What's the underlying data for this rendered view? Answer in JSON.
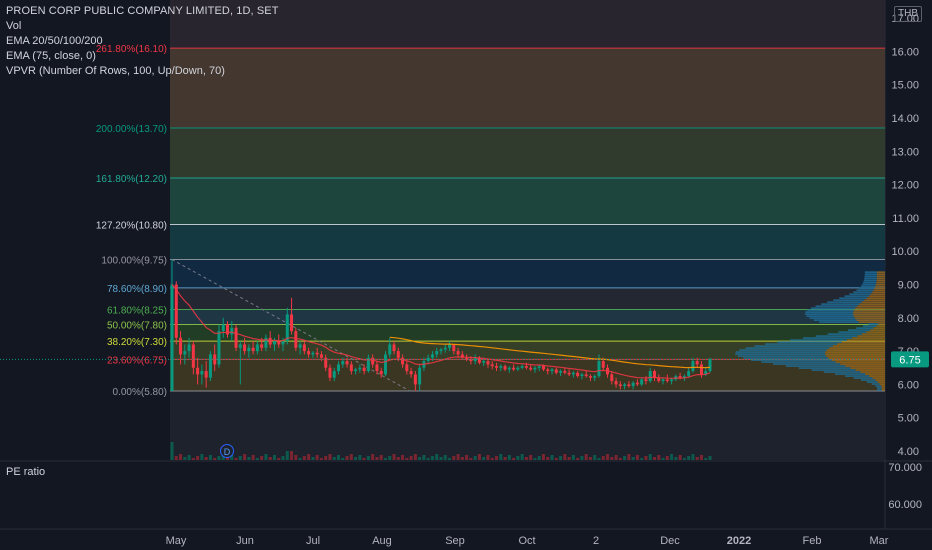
{
  "header": {
    "title": "PROEN CORP PUBLIC COMPANY LIMITED, 1D, SET",
    "indicators": [
      "Vol",
      "EMA 20/50/100/200",
      "EMA (75, close, 0)",
      "VPVR (Number Of Rows, 100, Up/Down, 70)"
    ],
    "currency": "THB"
  },
  "sub_pane": {
    "label": "PE ratio",
    "ticks": [
      "70.000",
      "60.000"
    ]
  },
  "chart_data": {
    "type": "candlestick",
    "symbol": "PROEN",
    "exchange": "SET",
    "interval": "1D",
    "currency": "THB",
    "ylim": [
      3.0,
      17.6
    ],
    "y_ticks": [
      "4.00",
      "5.00",
      "6.00",
      "7.00",
      "8.00",
      "9.00",
      "10.00",
      "11.00",
      "12.00",
      "13.00",
      "14.00",
      "15.00",
      "16.00",
      "17.00"
    ],
    "x_ticks": [
      "May",
      "Jun",
      "Jul",
      "Aug",
      "Sep",
      "Oct",
      "2",
      "Dec",
      "2022",
      "Feb",
      "Mar"
    ],
    "last_price": "6.75",
    "fibonacci": [
      {
        "label": "261.80%(16.10)",
        "price": 16.1,
        "color": "#f23645"
      },
      {
        "label": "200.00%(13.70)",
        "price": 13.7,
        "color": "#089981"
      },
      {
        "label": "161.80%(12.20)",
        "price": 12.2,
        "color": "#22ab94"
      },
      {
        "label": "127.20%(10.80)",
        "price": 10.8,
        "color": "#d1d4dc"
      },
      {
        "label": "100.00%(9.75)",
        "price": 9.75,
        "color": "#9598a1"
      },
      {
        "label": "78.60%(8.90)",
        "price": 8.9,
        "color": "#5fa8d3"
      },
      {
        "label": "61.80%(8.25)",
        "price": 8.25,
        "color": "#4caf50"
      },
      {
        "label": "50.00%(7.80)",
        "price": 7.8,
        "color": "#8bc34a"
      },
      {
        "label": "38.20%(7.30)",
        "price": 7.3,
        "color": "#cddc39"
      },
      {
        "label": "23.60%(6.75)",
        "price": 6.75,
        "color": "#f23645"
      },
      {
        "label": "0.00%(5.80)",
        "price": 5.8,
        "color": "#9598a1"
      }
    ],
    "dividend_marker": "D",
    "candles": [
      [
        0,
        5.8,
        9.75,
        5.8,
        9.0
      ],
      [
        1,
        9.0,
        9.1,
        7.2,
        7.4
      ],
      [
        2,
        7.4,
        7.6,
        6.6,
        6.9
      ],
      [
        3,
        6.9,
        7.2,
        6.6,
        7.0
      ],
      [
        4,
        7.0,
        7.4,
        6.8,
        7.2
      ],
      [
        5,
        7.2,
        7.3,
        6.3,
        6.5
      ],
      [
        6,
        6.5,
        6.8,
        6.0,
        6.3
      ],
      [
        7,
        6.3,
        6.6,
        6.0,
        6.4
      ],
      [
        8,
        6.4,
        6.7,
        5.9,
        6.2
      ],
      [
        9,
        6.2,
        7.0,
        6.1,
        6.9
      ],
      [
        10,
        6.9,
        7.2,
        6.4,
        6.6
      ],
      [
        11,
        6.6,
        7.8,
        6.5,
        7.6
      ],
      [
        12,
        7.6,
        8.0,
        7.4,
        7.8
      ],
      [
        13,
        7.8,
        7.9,
        7.4,
        7.5
      ],
      [
        14,
        7.5,
        7.9,
        7.3,
        7.7
      ],
      [
        15,
        7.7,
        7.8,
        7.0,
        7.1
      ],
      [
        16,
        7.1,
        7.3,
        6.0,
        7.2
      ],
      [
        17,
        7.2,
        7.4,
        6.9,
        7.0
      ],
      [
        18,
        7.0,
        7.2,
        6.8,
        7.1
      ],
      [
        19,
        7.1,
        7.3,
        6.9,
        7.0
      ],
      [
        20,
        7.0,
        7.3,
        6.9,
        7.2
      ],
      [
        21,
        7.2,
        7.4,
        7.0,
        7.1
      ],
      [
        22,
        7.1,
        7.5,
        7.0,
        7.4
      ],
      [
        23,
        7.4,
        7.6,
        7.1,
        7.2
      ],
      [
        24,
        7.2,
        7.4,
        7.0,
        7.3
      ],
      [
        25,
        7.3,
        7.5,
        7.1,
        7.2
      ],
      [
        26,
        7.2,
        7.4,
        7.0,
        7.3
      ],
      [
        27,
        7.3,
        8.3,
        7.2,
        8.1
      ],
      [
        28,
        8.1,
        8.6,
        7.5,
        7.6
      ],
      [
        29,
        7.6,
        7.7,
        7.0,
        7.1
      ],
      [
        30,
        7.1,
        7.3,
        6.9,
        7.2
      ],
      [
        31,
        7.2,
        7.3,
        6.9,
        7.0
      ],
      [
        32,
        7.0,
        7.1,
        6.8,
        6.9
      ],
      [
        33,
        6.9,
        7.0,
        6.8,
        6.95
      ],
      [
        34,
        6.95,
        7.1,
        6.8,
        6.9
      ],
      [
        35,
        6.9,
        7.0,
        6.7,
        6.8
      ],
      [
        36,
        6.8,
        6.9,
        6.4,
        6.5
      ],
      [
        37,
        6.5,
        6.6,
        6.1,
        6.2
      ],
      [
        38,
        6.2,
        6.5,
        6.1,
        6.4
      ],
      [
        39,
        6.4,
        6.7,
        6.3,
        6.6
      ],
      [
        40,
        6.6,
        6.8,
        6.5,
        6.7
      ],
      [
        41,
        6.7,
        6.8,
        6.5,
        6.6
      ],
      [
        42,
        6.6,
        6.7,
        6.3,
        6.4
      ],
      [
        43,
        6.4,
        6.5,
        6.3,
        6.45
      ],
      [
        44,
        6.45,
        6.6,
        6.35,
        6.5
      ],
      [
        45,
        6.5,
        6.6,
        6.3,
        6.4
      ],
      [
        46,
        6.4,
        6.9,
        6.35,
        6.8
      ],
      [
        47,
        6.8,
        6.9,
        6.5,
        6.6
      ],
      [
        48,
        6.6,
        6.7,
        6.3,
        6.4
      ],
      [
        49,
        6.4,
        6.5,
        6.2,
        6.3
      ],
      [
        50,
        6.3,
        7.0,
        6.25,
        6.9
      ],
      [
        51,
        6.9,
        7.4,
        6.8,
        7.2
      ],
      [
        52,
        7.2,
        7.3,
        6.9,
        7.0
      ],
      [
        53,
        7.0,
        7.1,
        6.7,
        6.8
      ],
      [
        54,
        6.8,
        6.9,
        6.5,
        6.6
      ],
      [
        55,
        6.6,
        6.7,
        6.3,
        6.4
      ],
      [
        56,
        6.4,
        6.5,
        6.2,
        6.3
      ],
      [
        57,
        6.3,
        6.4,
        5.8,
        6.0
      ],
      [
        58,
        6.0,
        6.6,
        5.8,
        6.5
      ],
      [
        59,
        6.5,
        6.8,
        6.4,
        6.7
      ],
      [
        60,
        6.7,
        6.9,
        6.6,
        6.8
      ],
      [
        61,
        6.8,
        7.0,
        6.7,
        6.9
      ],
      [
        62,
        6.9,
        7.1,
        6.8,
        7.0
      ],
      [
        63,
        7.0,
        7.1,
        6.9,
        7.05
      ],
      [
        64,
        7.05,
        7.2,
        6.95,
        7.1
      ],
      [
        65,
        7.1,
        7.3,
        7.0,
        7.2
      ],
      [
        66,
        7.2,
        7.2,
        6.9,
        7.0
      ],
      [
        67,
        7.0,
        7.1,
        6.8,
        6.9
      ],
      [
        68,
        6.9,
        7.0,
        6.75,
        6.8
      ],
      [
        69,
        6.8,
        6.9,
        6.7,
        6.75
      ],
      [
        70,
        6.75,
        6.85,
        6.6,
        6.7
      ],
      [
        71,
        6.7,
        6.9,
        6.6,
        6.8
      ],
      [
        72,
        6.8,
        6.85,
        6.6,
        6.65
      ],
      [
        73,
        6.65,
        6.8,
        6.55,
        6.7
      ],
      [
        74,
        6.7,
        6.75,
        6.5,
        6.6
      ],
      [
        75,
        6.6,
        6.7,
        6.45,
        6.55
      ],
      [
        76,
        6.55,
        6.65,
        6.4,
        6.5
      ],
      [
        77,
        6.5,
        6.6,
        6.4,
        6.55
      ],
      [
        78,
        6.55,
        6.6,
        6.4,
        6.45
      ],
      [
        79,
        6.45,
        6.55,
        6.35,
        6.5
      ],
      [
        80,
        6.5,
        6.6,
        6.4,
        6.45
      ],
      [
        81,
        6.45,
        6.55,
        6.4,
        6.5
      ],
      [
        82,
        6.5,
        6.6,
        6.45,
        6.55
      ],
      [
        83,
        6.55,
        6.65,
        6.45,
        6.5
      ],
      [
        84,
        6.5,
        6.6,
        6.4,
        6.45
      ],
      [
        85,
        6.45,
        6.55,
        6.35,
        6.5
      ],
      [
        86,
        6.5,
        6.6,
        6.4,
        6.55
      ],
      [
        87,
        6.55,
        6.6,
        6.4,
        6.45
      ],
      [
        88,
        6.45,
        6.5,
        6.3,
        6.4
      ],
      [
        89,
        6.4,
        6.5,
        6.3,
        6.45
      ],
      [
        90,
        6.45,
        6.5,
        6.3,
        6.35
      ],
      [
        91,
        6.35,
        6.45,
        6.25,
        6.4
      ],
      [
        92,
        6.4,
        6.5,
        6.3,
        6.35
      ],
      [
        93,
        6.35,
        6.45,
        6.25,
        6.3
      ],
      [
        94,
        6.3,
        6.4,
        6.2,
        6.35
      ],
      [
        95,
        6.35,
        6.4,
        6.2,
        6.25
      ],
      [
        96,
        6.25,
        6.35,
        6.15,
        6.3
      ],
      [
        97,
        6.3,
        6.4,
        6.2,
        6.25
      ],
      [
        98,
        6.25,
        6.3,
        6.1,
        6.2
      ],
      [
        99,
        6.2,
        6.3,
        6.1,
        6.25
      ],
      [
        100,
        6.25,
        6.9,
        6.2,
        6.7
      ],
      [
        101,
        6.7,
        6.8,
        6.4,
        6.5
      ],
      [
        102,
        6.5,
        6.6,
        6.2,
        6.3
      ],
      [
        103,
        6.3,
        6.4,
        6.0,
        6.1
      ],
      [
        104,
        6.1,
        6.2,
        5.9,
        6.0
      ],
      [
        105,
        6.0,
        6.1,
        5.85,
        5.95
      ],
      [
        106,
        5.95,
        6.05,
        5.85,
        6.0
      ],
      [
        107,
        6.0,
        6.1,
        5.9,
        5.95
      ],
      [
        108,
        5.95,
        6.1,
        5.85,
        6.05
      ],
      [
        109,
        6.05,
        6.15,
        5.95,
        6.0
      ],
      [
        110,
        6.0,
        6.2,
        5.95,
        6.15
      ],
      [
        111,
        6.15,
        6.25,
        6.0,
        6.1
      ],
      [
        112,
        6.1,
        6.5,
        6.05,
        6.4
      ],
      [
        113,
        6.4,
        6.45,
        6.1,
        6.2
      ],
      [
        114,
        6.2,
        6.3,
        6.05,
        6.1
      ],
      [
        115,
        6.1,
        6.2,
        6.0,
        6.15
      ],
      [
        116,
        6.15,
        6.3,
        6.05,
        6.1
      ],
      [
        117,
        6.1,
        6.2,
        6.0,
        6.15
      ],
      [
        118,
        6.15,
        6.3,
        6.1,
        6.25
      ],
      [
        119,
        6.25,
        6.35,
        6.15,
        6.2
      ],
      [
        120,
        6.2,
        6.3,
        6.1,
        6.25
      ],
      [
        121,
        6.25,
        6.5,
        6.2,
        6.4
      ],
      [
        122,
        6.4,
        6.8,
        6.35,
        6.7
      ],
      [
        123,
        6.7,
        6.8,
        6.5,
        6.6
      ],
      [
        124,
        6.6,
        6.7,
        6.2,
        6.3
      ],
      [
        125,
        6.3,
        6.5,
        6.25,
        6.4
      ],
      [
        126,
        6.4,
        6.8,
        6.35,
        6.75
      ]
    ]
  }
}
